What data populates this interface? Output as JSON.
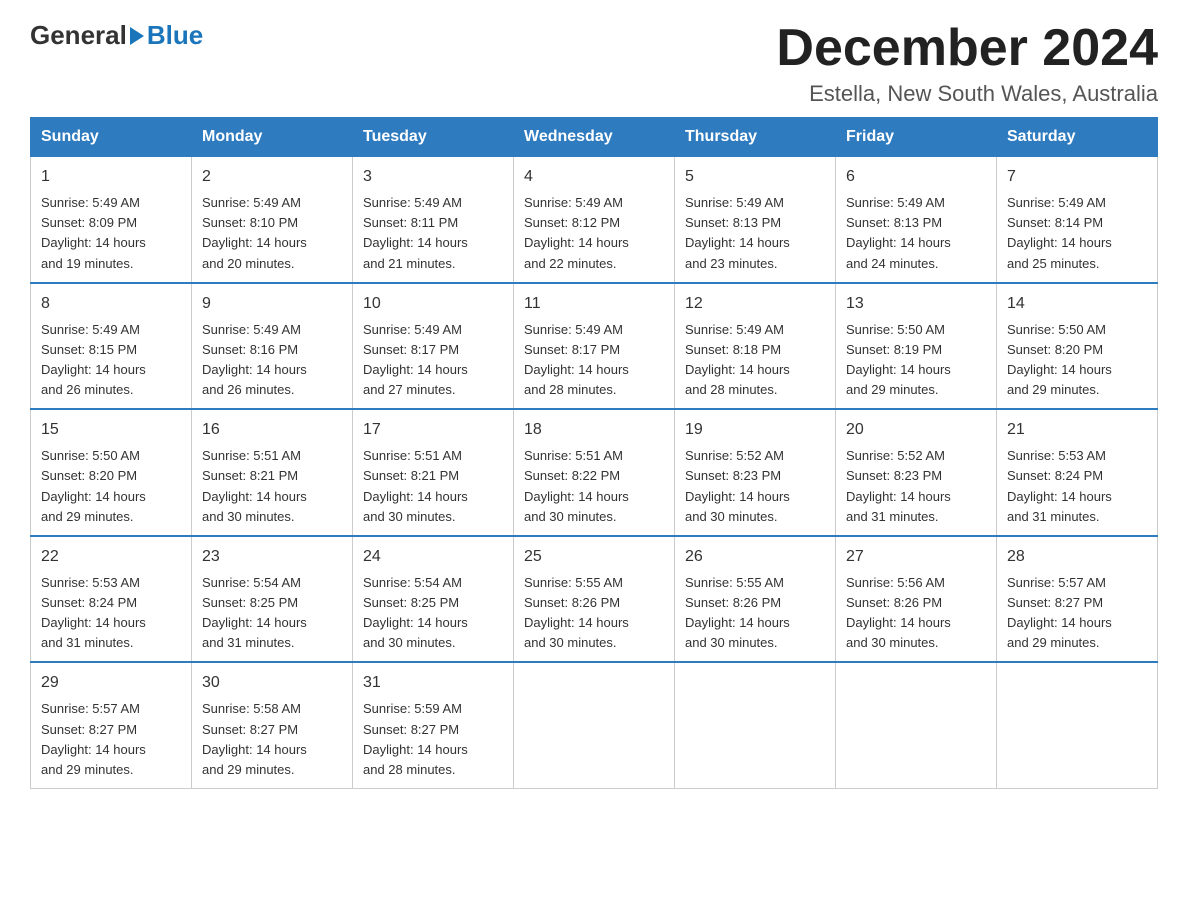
{
  "logo": {
    "general": "General",
    "blue": "Blue"
  },
  "title": "December 2024",
  "subtitle": "Estella, New South Wales, Australia",
  "weekdays": [
    "Sunday",
    "Monday",
    "Tuesday",
    "Wednesday",
    "Thursday",
    "Friday",
    "Saturday"
  ],
  "weeks": [
    [
      {
        "day": "1",
        "sunrise": "5:49 AM",
        "sunset": "8:09 PM",
        "daylight": "14 hours and 19 minutes."
      },
      {
        "day": "2",
        "sunrise": "5:49 AM",
        "sunset": "8:10 PM",
        "daylight": "14 hours and 20 minutes."
      },
      {
        "day": "3",
        "sunrise": "5:49 AM",
        "sunset": "8:11 PM",
        "daylight": "14 hours and 21 minutes."
      },
      {
        "day": "4",
        "sunrise": "5:49 AM",
        "sunset": "8:12 PM",
        "daylight": "14 hours and 22 minutes."
      },
      {
        "day": "5",
        "sunrise": "5:49 AM",
        "sunset": "8:13 PM",
        "daylight": "14 hours and 23 minutes."
      },
      {
        "day": "6",
        "sunrise": "5:49 AM",
        "sunset": "8:13 PM",
        "daylight": "14 hours and 24 minutes."
      },
      {
        "day": "7",
        "sunrise": "5:49 AM",
        "sunset": "8:14 PM",
        "daylight": "14 hours and 25 minutes."
      }
    ],
    [
      {
        "day": "8",
        "sunrise": "5:49 AM",
        "sunset": "8:15 PM",
        "daylight": "14 hours and 26 minutes."
      },
      {
        "day": "9",
        "sunrise": "5:49 AM",
        "sunset": "8:16 PM",
        "daylight": "14 hours and 26 minutes."
      },
      {
        "day": "10",
        "sunrise": "5:49 AM",
        "sunset": "8:17 PM",
        "daylight": "14 hours and 27 minutes."
      },
      {
        "day": "11",
        "sunrise": "5:49 AM",
        "sunset": "8:17 PM",
        "daylight": "14 hours and 28 minutes."
      },
      {
        "day": "12",
        "sunrise": "5:49 AM",
        "sunset": "8:18 PM",
        "daylight": "14 hours and 28 minutes."
      },
      {
        "day": "13",
        "sunrise": "5:50 AM",
        "sunset": "8:19 PM",
        "daylight": "14 hours and 29 minutes."
      },
      {
        "day": "14",
        "sunrise": "5:50 AM",
        "sunset": "8:20 PM",
        "daylight": "14 hours and 29 minutes."
      }
    ],
    [
      {
        "day": "15",
        "sunrise": "5:50 AM",
        "sunset": "8:20 PM",
        "daylight": "14 hours and 29 minutes."
      },
      {
        "day": "16",
        "sunrise": "5:51 AM",
        "sunset": "8:21 PM",
        "daylight": "14 hours and 30 minutes."
      },
      {
        "day": "17",
        "sunrise": "5:51 AM",
        "sunset": "8:21 PM",
        "daylight": "14 hours and 30 minutes."
      },
      {
        "day": "18",
        "sunrise": "5:51 AM",
        "sunset": "8:22 PM",
        "daylight": "14 hours and 30 minutes."
      },
      {
        "day": "19",
        "sunrise": "5:52 AM",
        "sunset": "8:23 PM",
        "daylight": "14 hours and 30 minutes."
      },
      {
        "day": "20",
        "sunrise": "5:52 AM",
        "sunset": "8:23 PM",
        "daylight": "14 hours and 31 minutes."
      },
      {
        "day": "21",
        "sunrise": "5:53 AM",
        "sunset": "8:24 PM",
        "daylight": "14 hours and 31 minutes."
      }
    ],
    [
      {
        "day": "22",
        "sunrise": "5:53 AM",
        "sunset": "8:24 PM",
        "daylight": "14 hours and 31 minutes."
      },
      {
        "day": "23",
        "sunrise": "5:54 AM",
        "sunset": "8:25 PM",
        "daylight": "14 hours and 31 minutes."
      },
      {
        "day": "24",
        "sunrise": "5:54 AM",
        "sunset": "8:25 PM",
        "daylight": "14 hours and 30 minutes."
      },
      {
        "day": "25",
        "sunrise": "5:55 AM",
        "sunset": "8:26 PM",
        "daylight": "14 hours and 30 minutes."
      },
      {
        "day": "26",
        "sunrise": "5:55 AM",
        "sunset": "8:26 PM",
        "daylight": "14 hours and 30 minutes."
      },
      {
        "day": "27",
        "sunrise": "5:56 AM",
        "sunset": "8:26 PM",
        "daylight": "14 hours and 30 minutes."
      },
      {
        "day": "28",
        "sunrise": "5:57 AM",
        "sunset": "8:27 PM",
        "daylight": "14 hours and 29 minutes."
      }
    ],
    [
      {
        "day": "29",
        "sunrise": "5:57 AM",
        "sunset": "8:27 PM",
        "daylight": "14 hours and 29 minutes."
      },
      {
        "day": "30",
        "sunrise": "5:58 AM",
        "sunset": "8:27 PM",
        "daylight": "14 hours and 29 minutes."
      },
      {
        "day": "31",
        "sunrise": "5:59 AM",
        "sunset": "8:27 PM",
        "daylight": "14 hours and 28 minutes."
      },
      null,
      null,
      null,
      null
    ]
  ],
  "labels": {
    "sunrise": "Sunrise:",
    "sunset": "Sunset:",
    "daylight": "Daylight:"
  }
}
